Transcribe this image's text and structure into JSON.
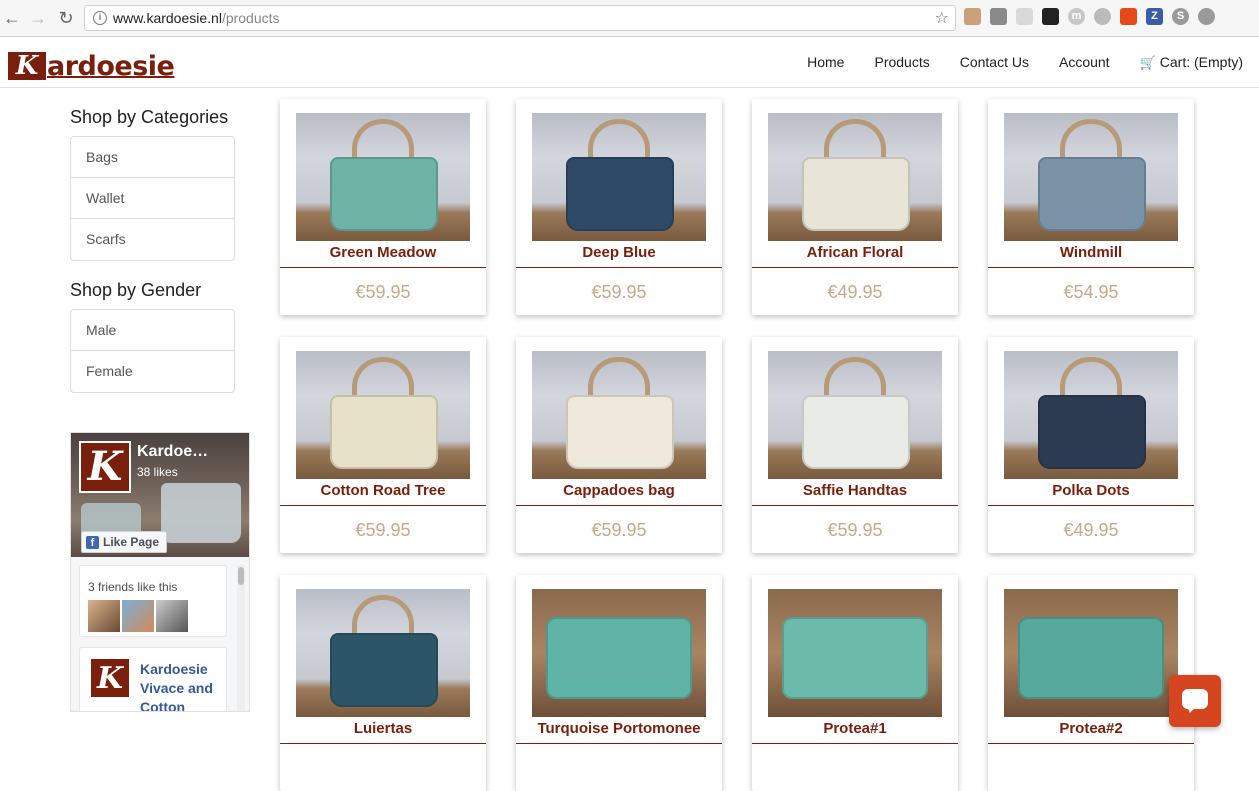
{
  "browser": {
    "url_host": "www.kardoesie.nl",
    "url_path": "/products"
  },
  "site": {
    "logo_letter": "K",
    "logo_text": "ardoesie",
    "nav": [
      "Home",
      "Products",
      "Contact Us",
      "Account"
    ],
    "cart_label": "Cart: (Empty)"
  },
  "sidebar": {
    "categories_title": "Shop by Categories",
    "categories": [
      "Bags",
      "Wallet",
      "Scarfs"
    ],
    "gender_title": "Shop by Gender",
    "genders": [
      "Male",
      "Female"
    ]
  },
  "facebook": {
    "page_name": "Kardoe…",
    "likes": "38 likes",
    "like_button": "Like Page",
    "friends_text": "3 friends like this",
    "post_name": "Kardoesie Vivace and Cotton"
  },
  "products": [
    {
      "name": "Green Meadow",
      "price": "€59.95",
      "color": "#6fb3a6"
    },
    {
      "name": "Deep Blue",
      "price": "€59.95",
      "color": "#2e4a66"
    },
    {
      "name": "African Floral",
      "price": "€49.95",
      "color": "#e8e4d8"
    },
    {
      "name": "Windmill",
      "price": "€54.95",
      "color": "#7a93a6"
    },
    {
      "name": "Cotton Road Tree",
      "price": "€59.95",
      "color": "#e6e1c8"
    },
    {
      "name": "Cappadoes bag",
      "price": "€59.95",
      "color": "#efe9dc"
    },
    {
      "name": "Saffie Handtas",
      "price": "€59.95",
      "color": "#e9ebe6"
    },
    {
      "name": "Polka Dots",
      "price": "€49.95",
      "color": "#2d3b52"
    },
    {
      "name": "Luiertas",
      "price": "",
      "color": "#2c5668"
    },
    {
      "name": "Turquoise Portomonee",
      "price": "",
      "color": "#5fb3a7"
    },
    {
      "name": "Protea#1",
      "price": "",
      "color": "#6cbaa9"
    },
    {
      "name": "Protea#2",
      "price": "",
      "color": "#56a99b"
    }
  ]
}
